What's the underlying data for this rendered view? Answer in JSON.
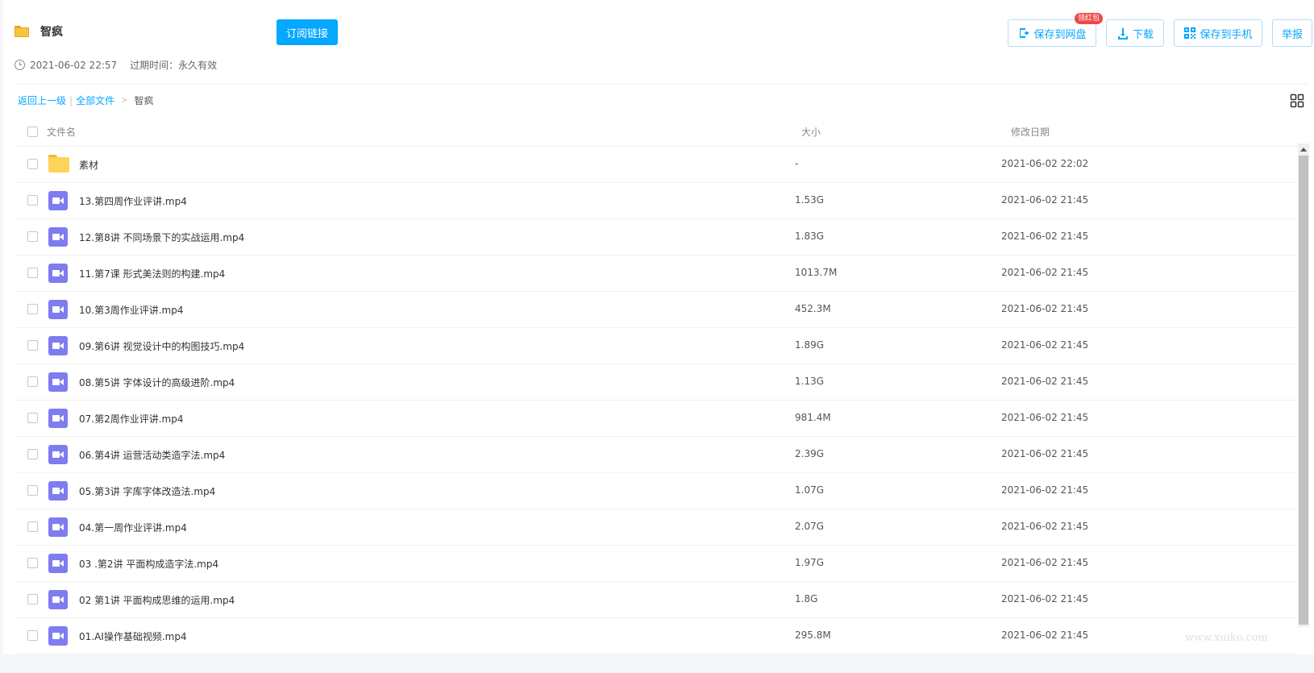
{
  "header": {
    "title": "智疯",
    "subscribe_label": "订阅链接",
    "created_time": "2021-06-02 22:57",
    "expire_label": "过期时间：永久有效",
    "actions": {
      "save_disk": "保存到网盘",
      "badge": "领红包",
      "download": "下载",
      "save_phone": "保存到手机",
      "report": "举报"
    }
  },
  "breadcrumb": {
    "back": "返回上一级",
    "all_files": "全部文件",
    "current": "智疯"
  },
  "table": {
    "columns": {
      "name": "文件名",
      "size": "大小",
      "date": "修改日期"
    },
    "rows": [
      {
        "type": "folder",
        "name": "素材",
        "size": "-",
        "date": "2021-06-02 22:02"
      },
      {
        "type": "video",
        "name": "13.第四周作业评讲.mp4",
        "size": "1.53G",
        "date": "2021-06-02 21:45"
      },
      {
        "type": "video",
        "name": "12.第8讲 不同场景下的实战运用.mp4",
        "size": "1.83G",
        "date": "2021-06-02 21:45"
      },
      {
        "type": "video",
        "name": "11.第7课 形式美法则的构建.mp4",
        "size": "1013.7M",
        "date": "2021-06-02 21:45"
      },
      {
        "type": "video",
        "name": "10.第3周作业评讲.mp4",
        "size": "452.3M",
        "date": "2021-06-02 21:45"
      },
      {
        "type": "video",
        "name": "09.第6讲 视觉设计中的构图技巧.mp4",
        "size": "1.89G",
        "date": "2021-06-02 21:45"
      },
      {
        "type": "video",
        "name": "08.第5讲 字体设计的高级进阶.mp4",
        "size": "1.13G",
        "date": "2021-06-02 21:45"
      },
      {
        "type": "video",
        "name": "07.第2周作业评讲.mp4",
        "size": "981.4M",
        "date": "2021-06-02 21:45"
      },
      {
        "type": "video",
        "name": "06.第4讲 运营活动类造字法.mp4",
        "size": "2.39G",
        "date": "2021-06-02 21:45"
      },
      {
        "type": "video",
        "name": "05.第3讲 字库字体改造法.mp4",
        "size": "1.07G",
        "date": "2021-06-02 21:45"
      },
      {
        "type": "video",
        "name": "04.第一周作业评讲.mp4",
        "size": "2.07G",
        "date": "2021-06-02 21:45"
      },
      {
        "type": "video",
        "name": "03 .第2讲 平面构成造字法.mp4",
        "size": "1.97G",
        "date": "2021-06-02 21:45"
      },
      {
        "type": "video",
        "name": "02 第1讲 平面构成思维的运用.mp4",
        "size": "1.8G",
        "date": "2021-06-02 21:45"
      },
      {
        "type": "video",
        "name": "01.AI操作基础视频.mp4",
        "size": "295.8M",
        "date": "2021-06-02 21:45"
      }
    ]
  },
  "watermark": "www.xuiko.com",
  "colors": {
    "accent": "#06a7ff",
    "video_icon": "#7e7cf0",
    "folder_icon": "#ffd259",
    "badge": "#f04848"
  }
}
